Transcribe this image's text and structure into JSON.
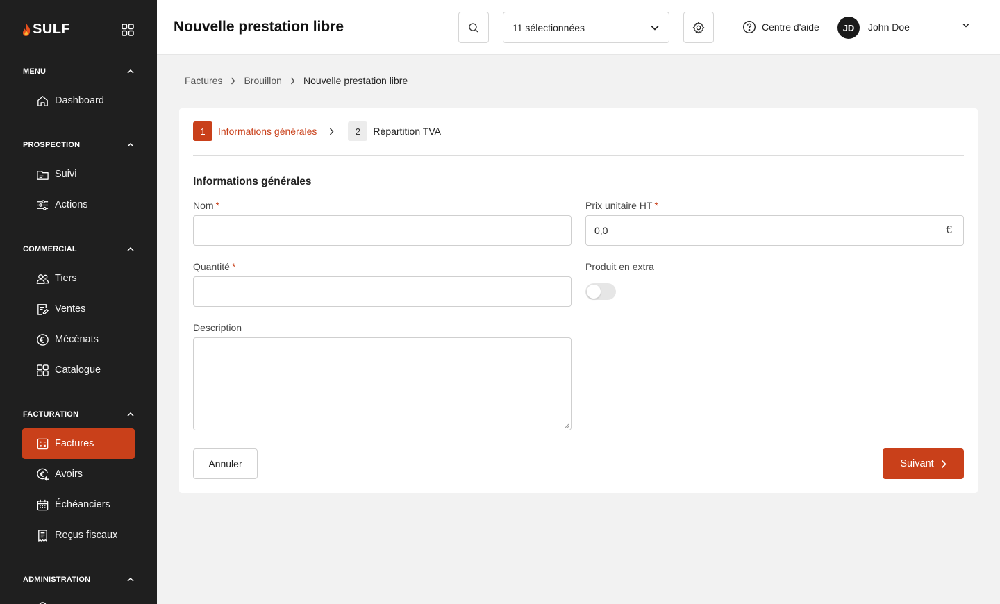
{
  "brand": {
    "name": "SULF",
    "accent": "#c9401a",
    "sidebar_bg": "#1f1f1f"
  },
  "sidebar": {
    "sections": [
      {
        "title": "MENU",
        "items": [
          {
            "label": "Dashboard",
            "icon": "home-icon"
          }
        ]
      },
      {
        "title": "PROSPECTION",
        "items": [
          {
            "label": "Suivi",
            "icon": "folder-icon"
          },
          {
            "label": "Actions",
            "icon": "actions-icon"
          }
        ]
      },
      {
        "title": "COMMERCIAL",
        "items": [
          {
            "label": "Tiers",
            "icon": "users-icon"
          },
          {
            "label": "Ventes",
            "icon": "edit-document-icon"
          },
          {
            "label": "Mécénats",
            "icon": "euro-circle-icon"
          },
          {
            "label": "Catalogue",
            "icon": "grid-icon"
          }
        ]
      },
      {
        "title": "FACTURATION",
        "items": [
          {
            "label": "Factures",
            "icon": "invoice-icon",
            "active": true
          },
          {
            "label": "Avoirs",
            "icon": "euro-refund-icon"
          },
          {
            "label": "Échéanciers",
            "icon": "calendar-icon"
          },
          {
            "label": "Reçus fiscaux",
            "icon": "receipt-icon"
          }
        ]
      },
      {
        "title": "ADMINISTRATION",
        "items": []
      }
    ]
  },
  "header": {
    "title": "Nouvelle prestation libre",
    "selection": "11 sélectionnées",
    "help": "Centre d'aide",
    "user": {
      "initials": "JD",
      "name": "John Doe"
    }
  },
  "breadcrumb": [
    "Factures",
    "Brouillon",
    "Nouvelle prestation libre"
  ],
  "stepper": [
    {
      "num": "1",
      "label": "Informations générales",
      "active": true
    },
    {
      "num": "2",
      "label": "Répartition TVA",
      "active": false
    }
  ],
  "form": {
    "section_title": "Informations générales",
    "nom_label": "Nom",
    "nom_value": "",
    "prix_label": "Prix unitaire HT",
    "prix_value": "0,0",
    "currency": "€",
    "quantite_label": "Quantité",
    "quantite_value": "",
    "extra_label": "Produit en extra",
    "extra_enabled": false,
    "description_label": "Description",
    "required_mark": "*",
    "cancel": "Annuler",
    "next": "Suivant"
  }
}
